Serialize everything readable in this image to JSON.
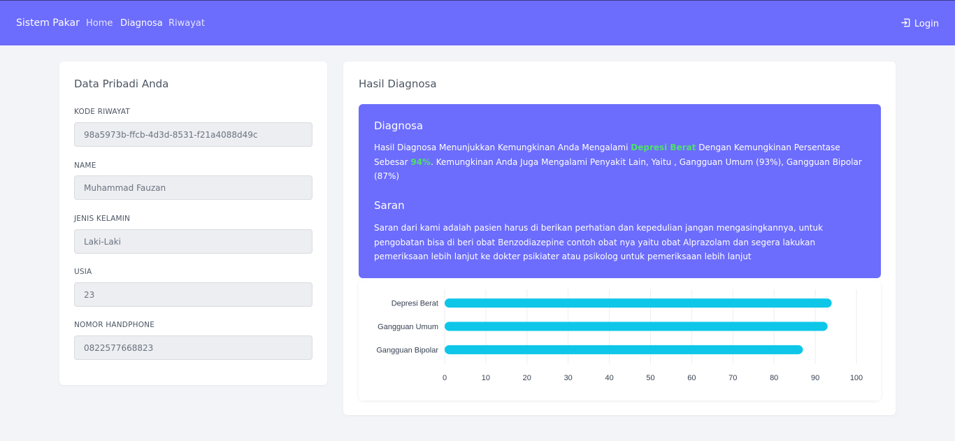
{
  "navbar": {
    "brand": "Sistem Pakar",
    "links": [
      {
        "label": "Home",
        "active": false
      },
      {
        "label": "Diagnosa",
        "active": true
      },
      {
        "label": "Riwayat",
        "active": false
      }
    ],
    "login_label": "Login",
    "login_icon": "login-icon",
    "bg_color": "#6c6cfd"
  },
  "personal": {
    "title": "Data Pribadi Anda",
    "fields": [
      {
        "label": "KODE RIWAYAT",
        "value": "98a5973b-ffcb-4d3d-8531-f21a4088d49c"
      },
      {
        "label": "NAME",
        "value": "Muhammad Fauzan"
      },
      {
        "label": "JENIS KELAMIN",
        "value": "Laki-Laki"
      },
      {
        "label": "USIA",
        "value": "23"
      },
      {
        "label": "NOMOR HANDPHONE",
        "value": "0822577668823"
      }
    ]
  },
  "result": {
    "title": "Hasil Diagnosa",
    "diagnosis": {
      "heading": "Diagnosa",
      "text_before": "Hasil Diagnosa Menunjukkan Kemungkinan Anda Mengalami ",
      "disease": "Depresi Berat",
      "text_middle": " Dengan Kemungkinan Persentase Sebesar ",
      "percent": "94%",
      "text_after": ". Kemungkinan Anda Juga Mengalami Penyakit Lain, Yaitu , Gangguan Umum (93%), Gangguan Bipolar (87%)"
    },
    "advice": {
      "heading": "Saran",
      "text": "Saran dari kami adalah pasien harus di berikan perhatian dan kepedulian jangan mengasingkannya, untuk pengobatan bisa di beri obat Benzodiazepine contoh obat nya yaitu obat Alprazolam dan segera lakukan pemeriksaan lebih lanjut ke dokter psikiater atau psikolog untuk pemeriksaan lebih lanjut"
    },
    "highlight_color": "#4ee06a"
  },
  "chart_data": {
    "type": "bar",
    "orientation": "horizontal",
    "categories": [
      "Depresi Berat",
      "Gangguan Umum",
      "Gangguan Bipolar"
    ],
    "values": [
      94,
      93,
      87
    ],
    "xlim": [
      0,
      100
    ],
    "xticks": [
      0,
      10,
      20,
      30,
      40,
      50,
      60,
      70,
      80,
      90,
      100
    ],
    "bar_color": "#0ec7e8",
    "grid": true
  }
}
